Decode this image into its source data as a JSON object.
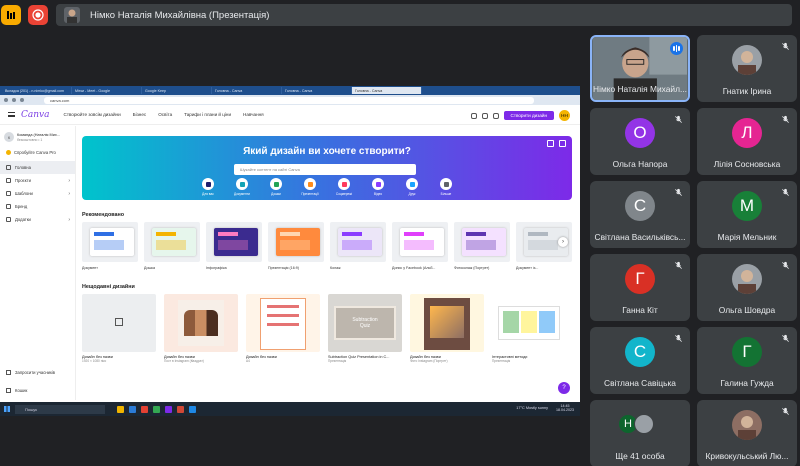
{
  "presenter": {
    "title": "Німко Наталія Михайлівна (Презентація)"
  },
  "browser": {
    "tabs": [
      "Вкладка (201) - n.nimko@gmail.com",
      "Мітки - Meet - Google",
      "Google Keep",
      "Головна - Canva",
      "Головна - Canva",
      "Головна - Canva"
    ],
    "url": "canva.com"
  },
  "canva": {
    "logo": "Canva",
    "nav": [
      "Створюйте зовсім дизайни",
      "Бізнес",
      "Освіта",
      "Тарифи і плани й ціни",
      "Навчання"
    ],
    "create_button": "Створити дизайн",
    "user_initials": "НН",
    "team_name": "Команда (Наталія Мих...",
    "team_sub": "безкоштовно • 1",
    "try_pro": "Спробуйте Canva Pro",
    "sidebar": [
      {
        "label": "Головна",
        "active": true
      },
      {
        "label": "Проєкти",
        "active": false
      },
      {
        "label": "Шаблони",
        "active": false
      },
      {
        "label": "Бренд",
        "active": false
      },
      {
        "label": "Додатки",
        "active": false
      }
    ],
    "invite": "Запросити учасників",
    "trash": "Кошик",
    "hero_title": "Який дизайн ви хочете створити?",
    "hero_search": "Шукайте контент на сайті Canva",
    "hero_icons": [
      {
        "label": "Для вас",
        "color": "#1f1f6e"
      },
      {
        "label": "Документи",
        "color": "#13a3b5"
      },
      {
        "label": "Дошки",
        "color": "#23a455"
      },
      {
        "label": "Презентації",
        "color": "#ff8c1a"
      },
      {
        "label": "Соцмережі",
        "color": "#ff3b5c"
      },
      {
        "label": "Відео",
        "color": "#8b3dff"
      },
      {
        "label": "Друк",
        "color": "#1aa3ff"
      },
      {
        "label": "Більше",
        "color": "#5f6368"
      }
    ],
    "recommended_title": "Рекомендовано",
    "recommended": [
      "Документ",
      "Дошка",
      "Інфографіка",
      "Презентація (16:9)",
      "Колаж",
      "Допис у Facebook (Альб...",
      "Фотоколаж (Портрет)",
      "Документ із..."
    ],
    "recent_title": "Нещодавні дизайни",
    "recent": [
      {
        "title": "Дизайн без назви",
        "sub": "1920 × 1080 пікс"
      },
      {
        "title": "Дизайн без назви",
        "sub": "Пост в Instagram (Квадрат)"
      },
      {
        "title": "Дизайн без назви",
        "sub": "A4"
      },
      {
        "title": "Subtraction Quiz Presentation in C...",
        "sub": "Презентація"
      },
      {
        "title": "Дизайн без назви",
        "sub": "Фото Instagram (Портрет)"
      },
      {
        "title": "Інтерактивні методи",
        "sub": "Презентація"
      }
    ],
    "help": "?"
  },
  "taskbar": {
    "search": "Пошук",
    "weather": "17°C  Mostly sunny",
    "time": "14:45",
    "date": "18.04.2023"
  },
  "participants": [
    {
      "name": "Німко Наталія Михайл...",
      "initial": "",
      "color": "",
      "speaking": true
    },
    {
      "name": "Гнатик Ірина",
      "initial": "",
      "color": "#9aa0a6",
      "muted": true
    },
    {
      "name": "Ольга Напора",
      "initial": "О",
      "color": "#9334e6",
      "muted": true
    },
    {
      "name": "Лілія Сосновська",
      "initial": "Л",
      "color": "#e52592",
      "muted": true
    },
    {
      "name": "Світлана Васильківсь...",
      "initial": "С",
      "color": "#80868b",
      "muted": true
    },
    {
      "name": "Марія Мельник",
      "initial": "М",
      "color": "#188038",
      "muted": true
    },
    {
      "name": "Ганна Кіт",
      "initial": "Г",
      "color": "#d93025",
      "muted": true
    },
    {
      "name": "Ольга Шовдра",
      "initial": "",
      "color": "#9aa0a6",
      "muted": true
    },
    {
      "name": "Світлана Савіцька",
      "initial": "С",
      "color": "#12b5cb",
      "muted": true
    },
    {
      "name": "Галина Гужда",
      "initial": "Г",
      "color": "#137333",
      "muted": true
    },
    {
      "name": "Ще 41 особа",
      "initial": "Н",
      "color": "#0d652d",
      "muted": false
    },
    {
      "name": "Кривокульський Лю...",
      "initial": "",
      "color": "#8d6e63",
      "muted": true
    }
  ]
}
